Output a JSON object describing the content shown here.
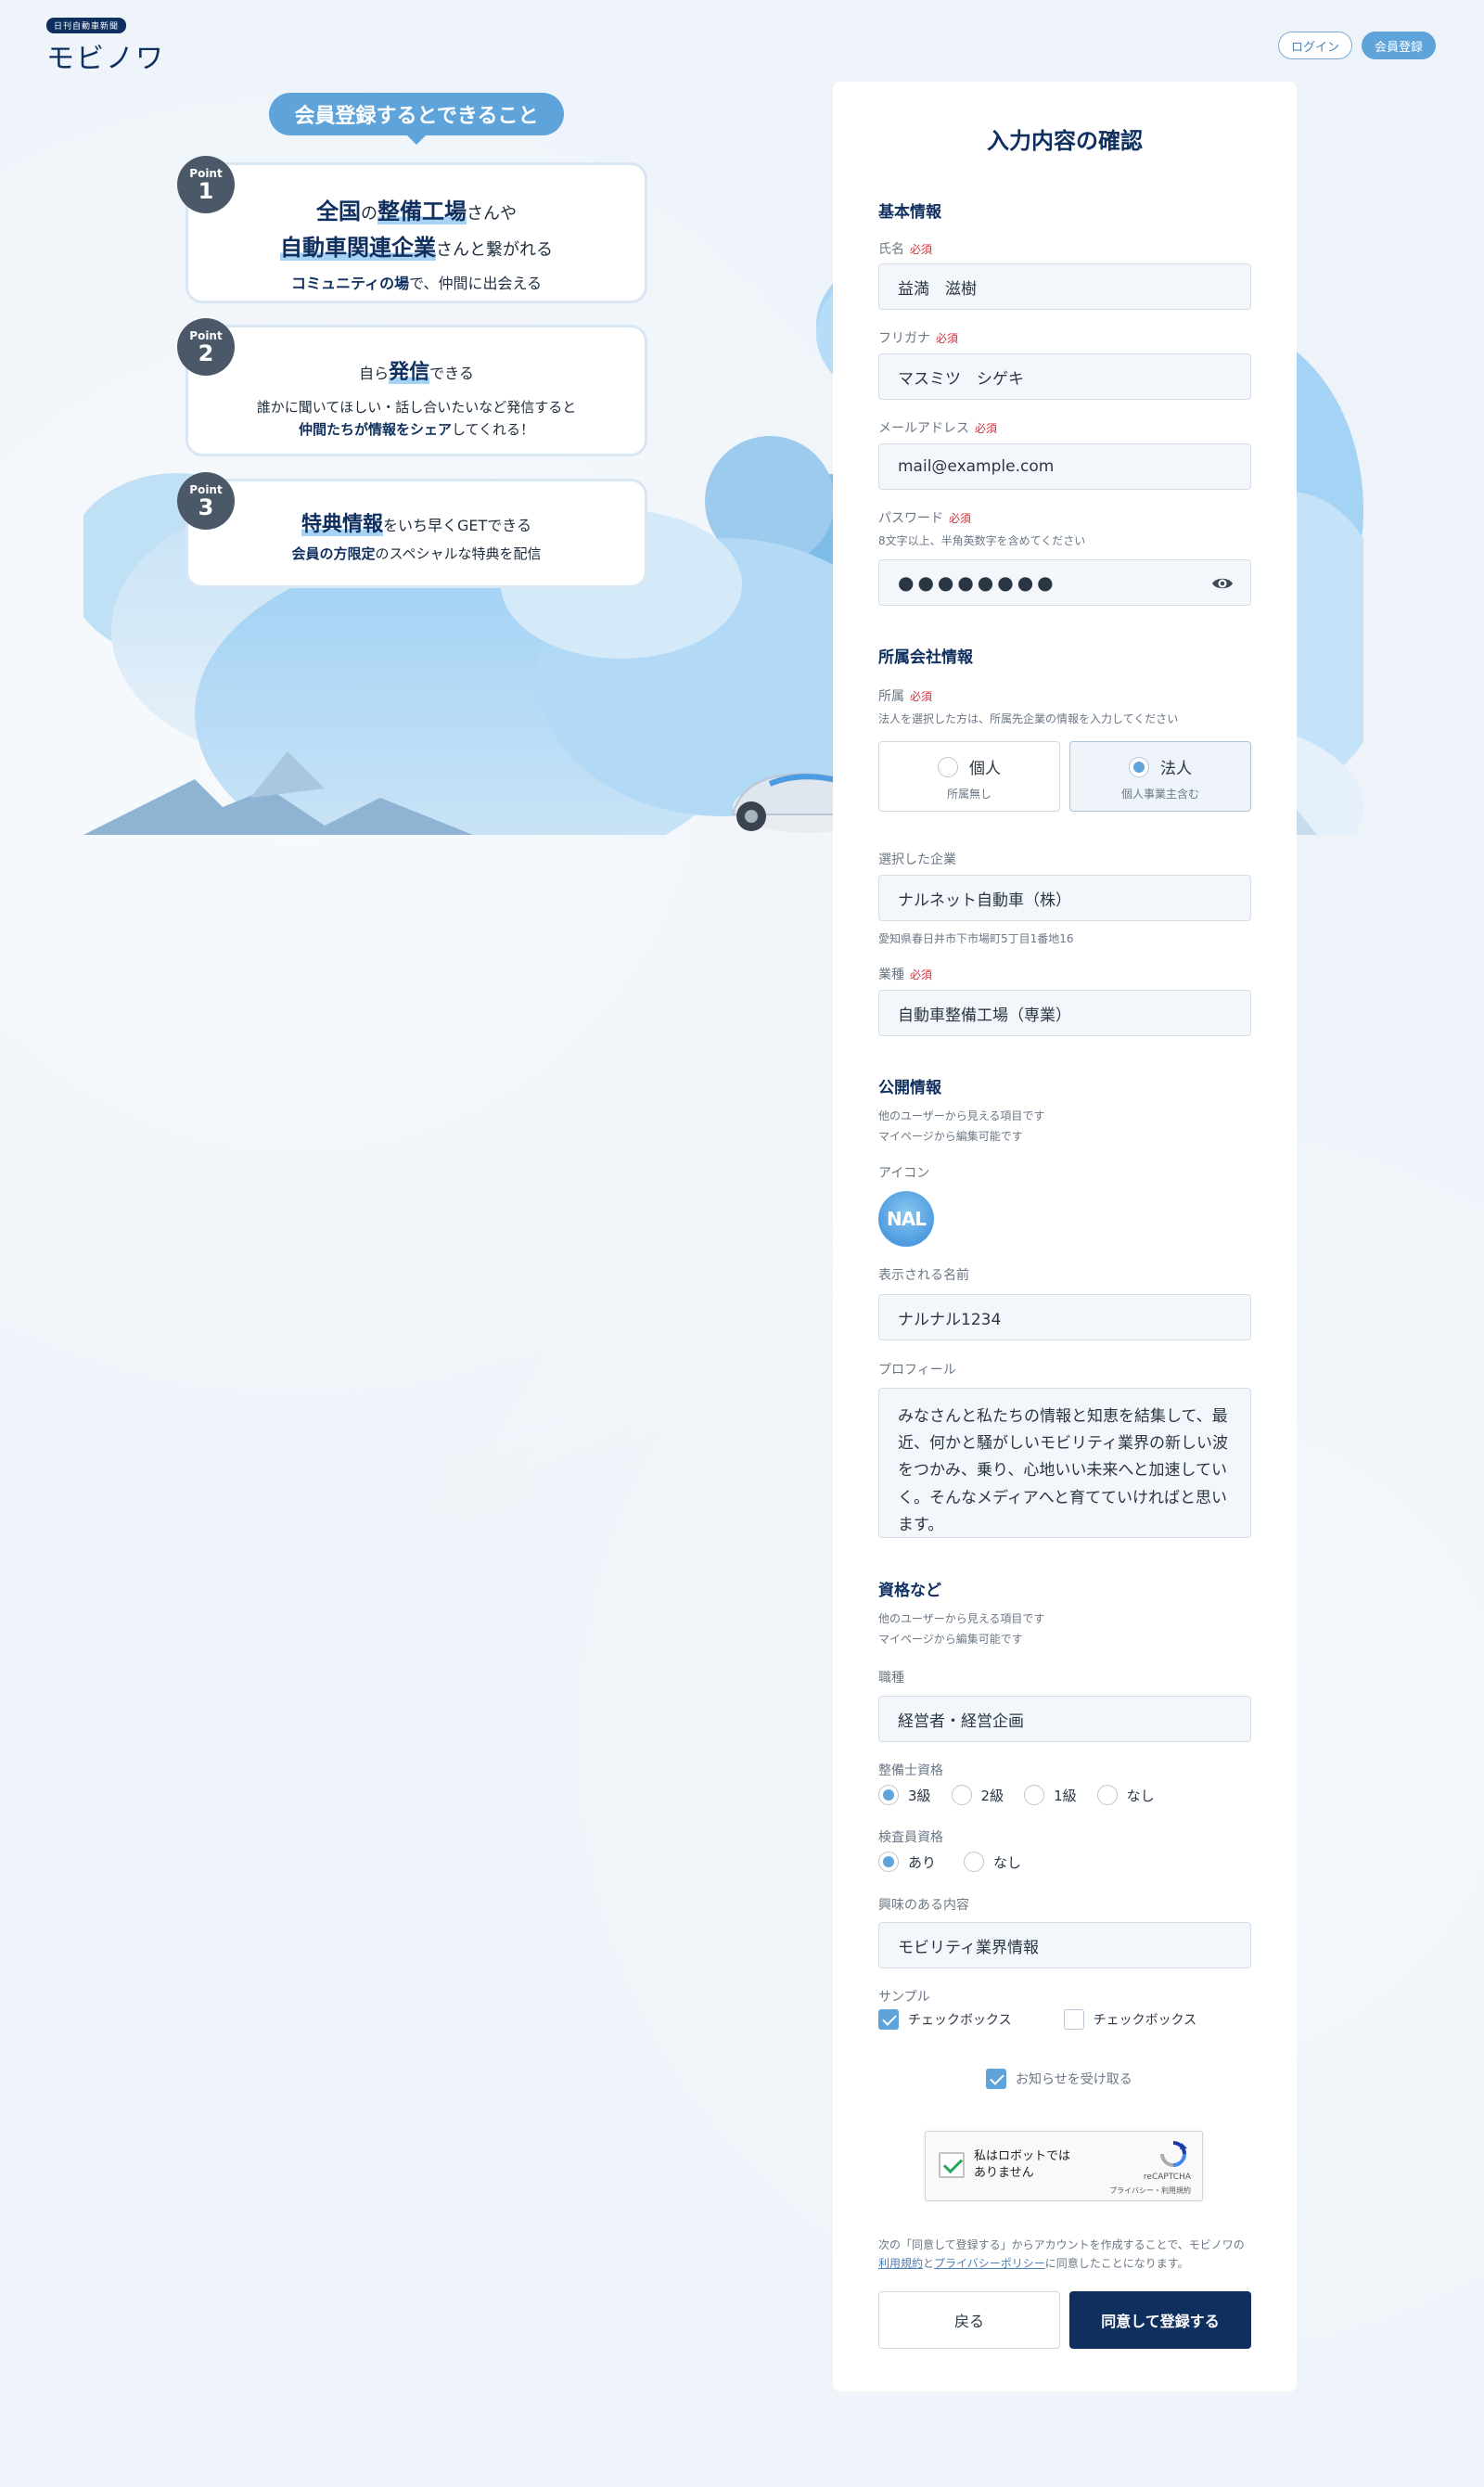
{
  "header": {
    "logo_badge": "日刊自動車新聞",
    "logo_text": "モビノワ",
    "login_label": "ログイン",
    "register_label": "会員登録"
  },
  "features": {
    "title": "会員登録するとできること",
    "points": [
      {
        "label": "Point",
        "number": "1",
        "l1a": "全国",
        "l1b": "の",
        "l1c": "整備工場",
        "l1d": "さんや",
        "l2a": "自動車関連企業",
        "l2b": "さんと繋がれる",
        "l3a": "コミュニティの場",
        "l3b": "で、仲間に出会える"
      },
      {
        "label": "Point",
        "number": "2",
        "l1a": "自ら",
        "l1b": "発信",
        "l1c": "できる",
        "l2": "誰かに聞いてほしい・話し合いたいなど発信すると",
        "l3a": "仲間たちが情報をシェア",
        "l3b": "してくれる！"
      },
      {
        "label": "Point",
        "number": "3",
        "l1a": "特典情報",
        "l1b": "をいち早くGETできる",
        "l2a": "会員の方限定",
        "l2b": "のスペシャルな特典を配信"
      }
    ]
  },
  "form": {
    "title": "入力内容の確認",
    "required": "必須",
    "basic": {
      "title": "基本情報",
      "name_label": "氏名",
      "name_value": "益満　滋樹",
      "kana_label": "フリガナ",
      "kana_value": "マスミツ　シゲキ",
      "email_label": "メールアドレス",
      "email_value": "mail@example.com",
      "password_label": "パスワード",
      "password_help": "8文字以上、半角英数字を含めてください",
      "password_value": "●●●●●●●●"
    },
    "company": {
      "title": "所属会社情報",
      "affiliation_label": "所属",
      "affiliation_help": "法人を選択した方は、所属先企業の情報を入力してください",
      "options": [
        {
          "label": "個人",
          "sub": "所属無し",
          "selected": false
        },
        {
          "label": "法人",
          "sub": "個人事業主含む",
          "selected": true
        }
      ],
      "selected_company_label": "選択した企業",
      "selected_company_value": "ナルネット自動車（株）",
      "address": "愛知県春日井市下市場町5丁目1番地16",
      "industry_label": "業種",
      "industry_value": "自動車整備工場（専業）"
    },
    "public": {
      "title": "公開情報",
      "help1": "他のユーザーから見える項目です",
      "help2": "マイページから編集可能です",
      "icon_label": "アイコン",
      "avatar_text": "NAL",
      "display_name_label": "表示される名前",
      "display_name_value": "ナルナル1234",
      "profile_label": "プロフィール",
      "profile_value": "みなさんと私たちの情報と知恵を結集して、最近、何かと騒がしいモビリティ業界の新しい波をつかみ、乗り、心地いい未来へと加速していく。そんなメディアへと育てていければと思います。"
    },
    "qualifications": {
      "title": "資格など",
      "help1": "他のユーザーから見える項目です",
      "help2": "マイページから編集可能です",
      "job_label": "職種",
      "job_value": "経営者・経営企画",
      "mechanic_label": "整備士資格",
      "mechanic_options": [
        {
          "label": "3級",
          "selected": true
        },
        {
          "label": "2級",
          "selected": false
        },
        {
          "label": "1級",
          "selected": false
        },
        {
          "label": "なし",
          "selected": false
        }
      ],
      "inspector_label": "検査員資格",
      "inspector_options": [
        {
          "label": "あり",
          "selected": true
        },
        {
          "label": "なし",
          "selected": false
        }
      ],
      "interest_label": "興味のある内容",
      "interest_value": "モビリティ業界情報",
      "sample_label": "サンプル",
      "sample_options": [
        {
          "label": "チェックボックス",
          "checked": true
        },
        {
          "label": "チェックボックス",
          "checked": false
        }
      ],
      "newsletter_label": "お知らせを受け取る",
      "newsletter_checked": true
    },
    "captcha": {
      "text": "私はロボットではありません",
      "brand": "reCAPTCHA",
      "links": "プライバシー・利用規約"
    },
    "note": {
      "t1": "次の「同意して登録する」からアカウントを作成することで、モビノワの",
      "terms": "利用規約",
      "t2": "と",
      "privacy": "プライバシーポリシー",
      "t3": "に同意したことになります。"
    },
    "back_label": "戻る",
    "submit_label": "同意して登録する"
  },
  "colors": {
    "navy": "#0f2f5f",
    "accent": "#5fa3db",
    "required": "#d0323c",
    "background": "#eef4fa"
  }
}
